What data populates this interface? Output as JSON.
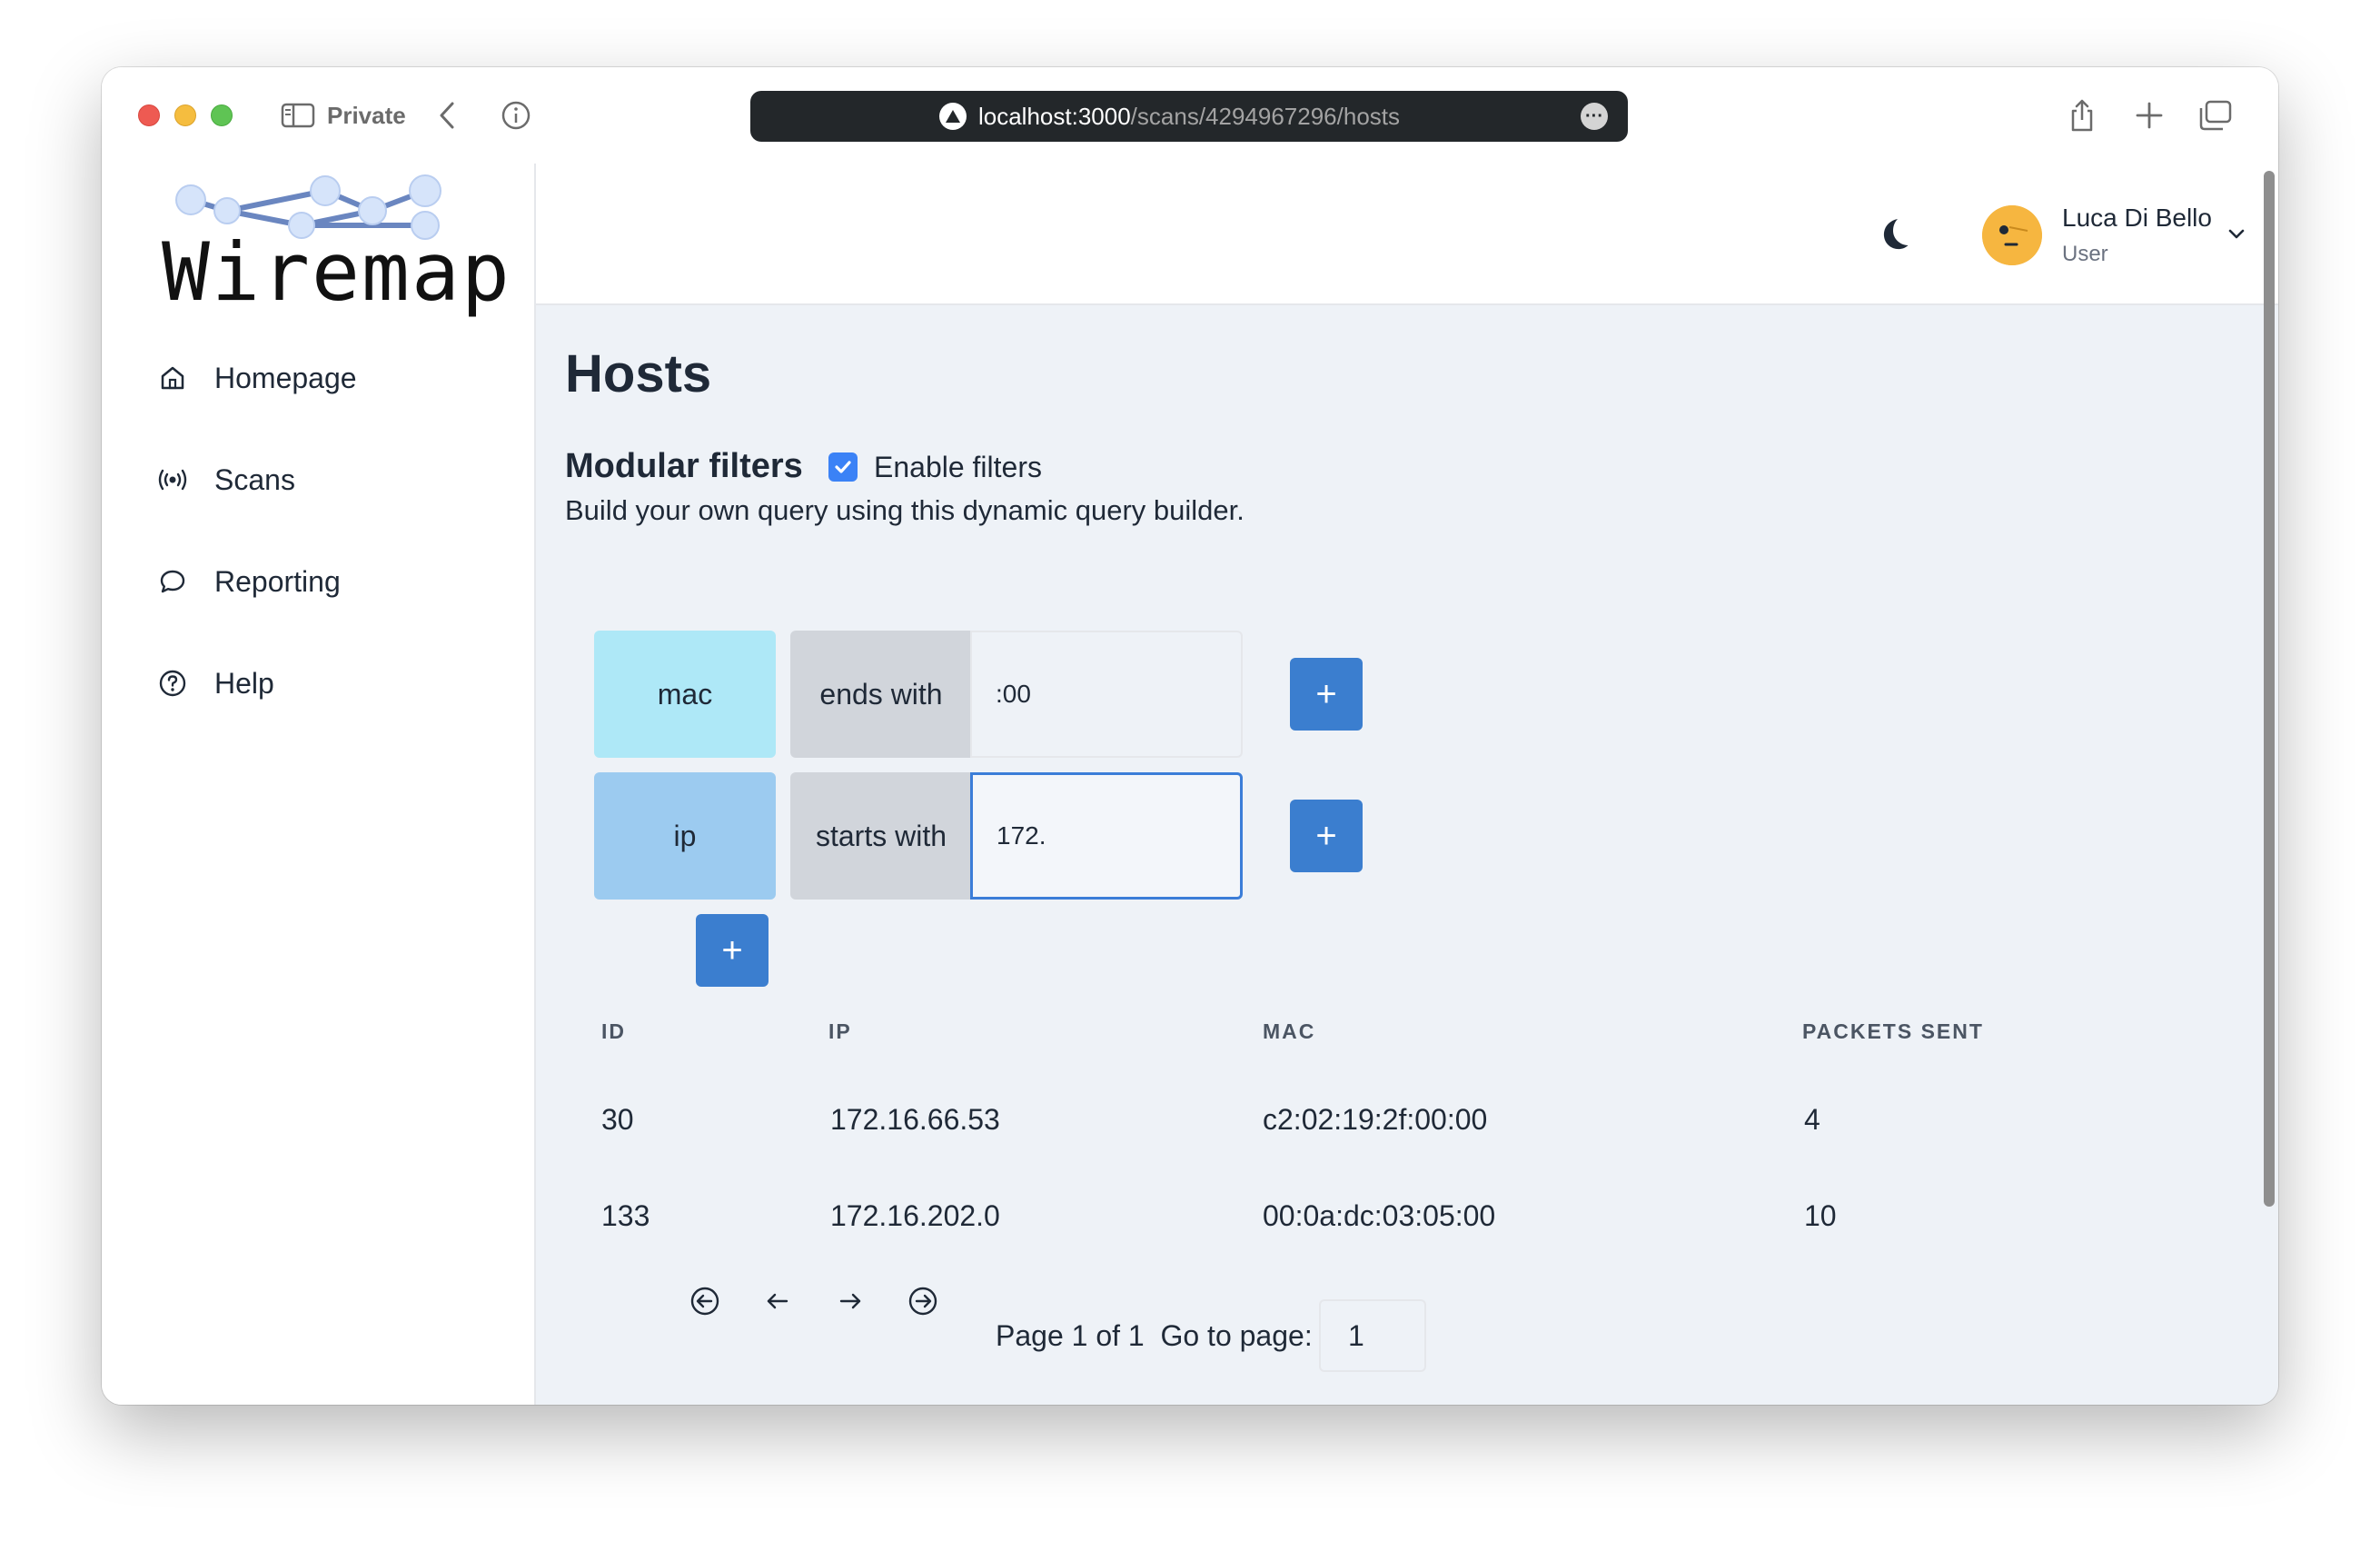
{
  "browser": {
    "private_label": "Private",
    "url_host": "localhost:3000",
    "url_path": "/scans/4294967296/hosts"
  },
  "app": {
    "logo_text": "Wiremap",
    "nav": [
      {
        "label": "Homepage",
        "icon": "home-icon"
      },
      {
        "label": "Scans",
        "icon": "broadcast-icon"
      },
      {
        "label": "Reporting",
        "icon": "chat-bubble-icon"
      },
      {
        "label": "Help",
        "icon": "help-circle-icon"
      }
    ],
    "user": {
      "name": "Luca Di Bello",
      "role": "User"
    }
  },
  "page": {
    "title": "Hosts",
    "filters_title": "Modular filters",
    "enable_filters_label": "Enable filters",
    "enable_filters_checked": true,
    "filters_description": "Build your own query using this dynamic query builder."
  },
  "query_builder": {
    "rules": [
      {
        "field": "mac",
        "operator": "ends with",
        "value": ":00",
        "field_color": "#aee8f7"
      },
      {
        "field": "ip",
        "operator": "starts with",
        "value": "172.",
        "field_color": "#9ccbf0"
      }
    ],
    "add_label": "+"
  },
  "table": {
    "columns": [
      "ID",
      "IP",
      "MAC",
      "PACKETS SENT"
    ],
    "rows": [
      [
        "30",
        "172.16.66.53",
        "c2:02:19:2f:00:00",
        "4"
      ],
      [
        "133",
        "172.16.202.0",
        "00:0a:dc:03:05:00",
        "10"
      ]
    ]
  },
  "pagination": {
    "page_text": "Page 1 of 1",
    "goto_label": "Go to page:",
    "goto_value": "1"
  },
  "colors": {
    "accent": "#3b7ecf",
    "main_bg": "#eef2f7"
  }
}
